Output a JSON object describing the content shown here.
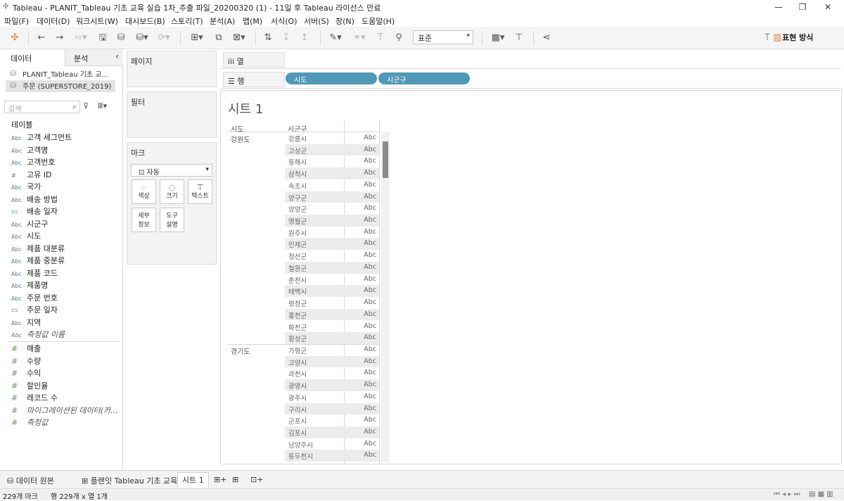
{
  "window": {
    "title": "Tableau - PLANIT_Tableau 기초 교육 실습 1차_추출 파일_20200320 (1) - 11일 후 Tableau 라이선스 만료",
    "minimize": "—",
    "maximize": "❐",
    "close": "✕"
  },
  "menu": [
    "파일(F)",
    "데이터(D)",
    "워크시트(W)",
    "대시보드(B)",
    "스토리(T)",
    "분석(A)",
    "맵(M)",
    "서식(O)",
    "서버(S)",
    "창(N)",
    "도움말(H)"
  ],
  "toolbar": {
    "fit_value": "표준",
    "show_me_label": "표현 방식"
  },
  "left_pane": {
    "tab_data": "데이터",
    "tab_analysis": "분석",
    "collapse": "‹",
    "datasources": [
      "PLANIT_Tableau 기초 교...",
      "주문 (SUPERSTORE_2019)"
    ],
    "search_placeholder": "검색",
    "table_header": "테이블",
    "dimensions": [
      {
        "type": "Abc",
        "name": "고객 세그먼트"
      },
      {
        "type": "Abc",
        "name": "고객명"
      },
      {
        "type": "Abc",
        "name": "고객번호"
      },
      {
        "type": "#",
        "name": "고유 ID"
      },
      {
        "type": "Abc",
        "name": "국가"
      },
      {
        "type": "Abc",
        "name": "배송 방법"
      },
      {
        "type": "date",
        "name": "배송 일자"
      },
      {
        "type": "Abc",
        "name": "시군구"
      },
      {
        "type": "Abc",
        "name": "시도"
      },
      {
        "type": "Abc",
        "name": "제품 대분류"
      },
      {
        "type": "Abc",
        "name": "제품 중분류"
      },
      {
        "type": "Abc",
        "name": "제품 코드"
      },
      {
        "type": "Abc",
        "name": "제품명"
      },
      {
        "type": "Abc",
        "name": "주문 번호"
      },
      {
        "type": "date",
        "name": "주문 일자"
      },
      {
        "type": "Abc",
        "name": "지역"
      },
      {
        "type": "Abc",
        "name": "측정값 이름",
        "italic": true
      }
    ],
    "measures": [
      {
        "name": "매출"
      },
      {
        "name": "수량"
      },
      {
        "name": "수익"
      },
      {
        "name": "할인율"
      },
      {
        "name": "레코드 수"
      },
      {
        "name": "마이그레이션된 데이터(카...",
        "italic": true
      },
      {
        "name": "측정값",
        "italic": true
      }
    ]
  },
  "shelves": {
    "pages": "페이지",
    "filters": "필터",
    "marks": "마크",
    "marks_type": "자동",
    "mark_buttons": [
      "색상",
      "크기",
      "텍스트",
      "세부\n정보",
      "도구\n설명"
    ],
    "columns": "열",
    "rows": "행",
    "row_pills": [
      "시도",
      "시군구"
    ]
  },
  "view": {
    "title": "시트 1",
    "header_sido": "시도",
    "header_sigungu": "시군구",
    "groups": [
      {
        "sido": "강원도",
        "items": [
          "강릉시",
          "고성군",
          "동해시",
          "삼척시",
          "속초시",
          "양구군",
          "양양군",
          "영월군",
          "원주시",
          "인제군",
          "정선군",
          "철원군",
          "춘천시",
          "태백시",
          "평창군",
          "홍천군",
          "화천군",
          "횡성군"
        ]
      },
      {
        "sido": "경기도",
        "items": [
          "가평군",
          "고양시",
          "과천시",
          "광명시",
          "광주시",
          "구리시",
          "군포시",
          "김포시",
          "남양주시",
          "동두천시"
        ]
      }
    ],
    "cell_value": "Abc"
  },
  "tabs": [
    "데이터 원본",
    "플랜잇 Tableau 기초 교육",
    "시트 1"
  ],
  "status": {
    "marks": "229개 마크",
    "rows_cols": "행 229개  x  열 1개"
  }
}
